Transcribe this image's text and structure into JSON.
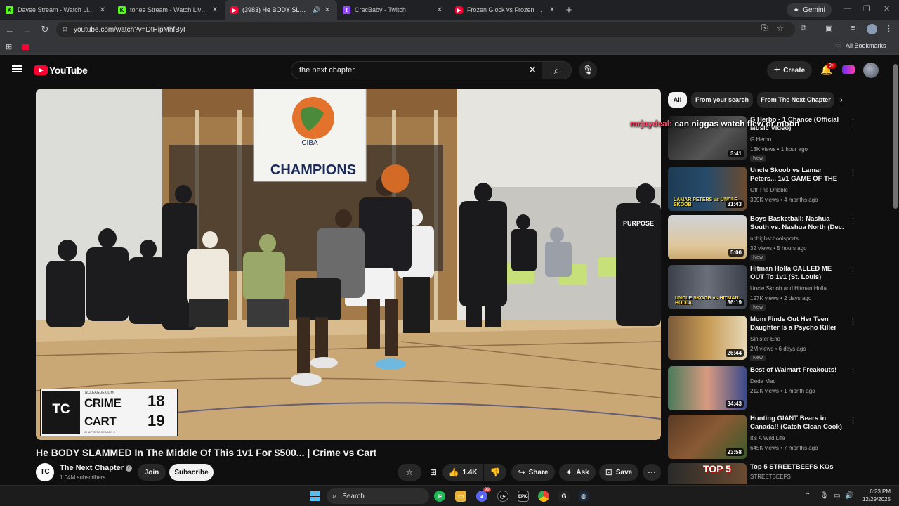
{
  "browser": {
    "tabs": [
      {
        "title": "Davee Stream - Watch Live on K",
        "icon": "kick-icon",
        "active": false
      },
      {
        "title": "tonee Stream - Watch Live on K",
        "icon": "kick-icon",
        "active": false
      },
      {
        "title": "(3983) He BODY SLAMMED",
        "icon": "youtube-icon",
        "active": true
      },
      {
        "title": "CracBaby - Twitch",
        "icon": "twitch-icon",
        "active": false
      },
      {
        "title": "Frozen Glock vs Frozen M&P - Y",
        "icon": "youtube-icon",
        "active": false
      }
    ],
    "new_tab_symbol": "+",
    "gemini_label": "Gemini",
    "url": "youtube.com/watch?v=DtHipMhfByI",
    "all_bookmarks": "All Bookmarks"
  },
  "youtube": {
    "logo_text": "YouTube",
    "search_value": "the next chapter",
    "create_label": "Create",
    "notification_count": "9+",
    "video": {
      "title": "He BODY SLAMMED In The Middle Of This 1v1 For $500... | Crime vs Cart",
      "channel": "The Next Chapter",
      "subscribers": "1.04M subscribers",
      "join_label": "Join",
      "subscribe_label": "Subscribe",
      "likes": "1.4K",
      "share_label": "Share",
      "ask_label": "Ask",
      "save_label": "Save"
    },
    "scoreboard": {
      "site": "TNCLEAGUE.COM",
      "logo": "TC",
      "player1": "CRIME",
      "score1": "18",
      "player2": "CART",
      "score2": "19",
      "subtitle": "CHAPTER 2 SEASON 3"
    },
    "gym_banner": {
      "org": "Carolina International Basketball Association",
      "abbr": "CIBA",
      "champions": "CHAMPIONS",
      "shirt": "PURPOSE"
    },
    "chips": [
      "All",
      "From your search",
      "From The Next Chapter"
    ],
    "chat_overlay": {
      "user": "mrjaydeal:",
      "message": "can niggas watch flew or moon"
    },
    "recommendations": [
      {
        "title": "G Herbo - 1 Chance (Official Music Video)",
        "channel": "G Herbo",
        "meta": "13K views • 1 hour ago",
        "duration": "3:41",
        "badge": "New"
      },
      {
        "title": "Uncle Skoob vs Lamar Peters... 1v1 GAME OF THE YEAR!? | ...",
        "channel": "Off The Dribble",
        "meta": "399K views • 4 months ago",
        "duration": "31:43",
        "badge": ""
      },
      {
        "title": "Boys Basketball: Nashua South vs. Nashua North (Dec. 28)",
        "channel": "nhhighschoolsports",
        "meta": "32 views • 5 hours ago",
        "duration": "5:00",
        "badge": "New"
      },
      {
        "title": "Hitman Holla CALLED ME OUT To 1v1 (St. Louis)",
        "channel": "Uncle Skoob and Hitman Holla",
        "meta": "197K views • 2 days ago",
        "duration": "36:19",
        "badge": "New"
      },
      {
        "title": "Mom Finds Out Her Teen Daughter Is a Psycho Killer",
        "channel": "Sinister End",
        "meta": "2M views • 6 days ago",
        "duration": "26:44",
        "badge": "New"
      },
      {
        "title": "Best of Walmart Freakouts!",
        "channel": "Deda Mac",
        "meta": "212K views • 1 month ago",
        "duration": "34:43",
        "badge": ""
      },
      {
        "title": "Hunting GIANT Bears in Canada!! (Catch Clean Cook)",
        "channel": "It's A Wild Life",
        "meta": "645K views • 7 months ago",
        "duration": "23:58",
        "badge": ""
      },
      {
        "title": "Top 5 STREETBEEFS KOs",
        "channel": "STREETBEEFS",
        "meta": "",
        "duration": "",
        "badge": ""
      }
    ],
    "thumb_texts": {
      "t2": "LAMAR PETERS vs UNCLE SKOOB",
      "t4": "UNCLE SKOOB vs HITMAN HOLLA",
      "t8": "TOP 5"
    }
  },
  "taskbar": {
    "search_label": "Search",
    "time": "6:23 PM",
    "date": "12/29/2025",
    "discord_badge": "99"
  }
}
